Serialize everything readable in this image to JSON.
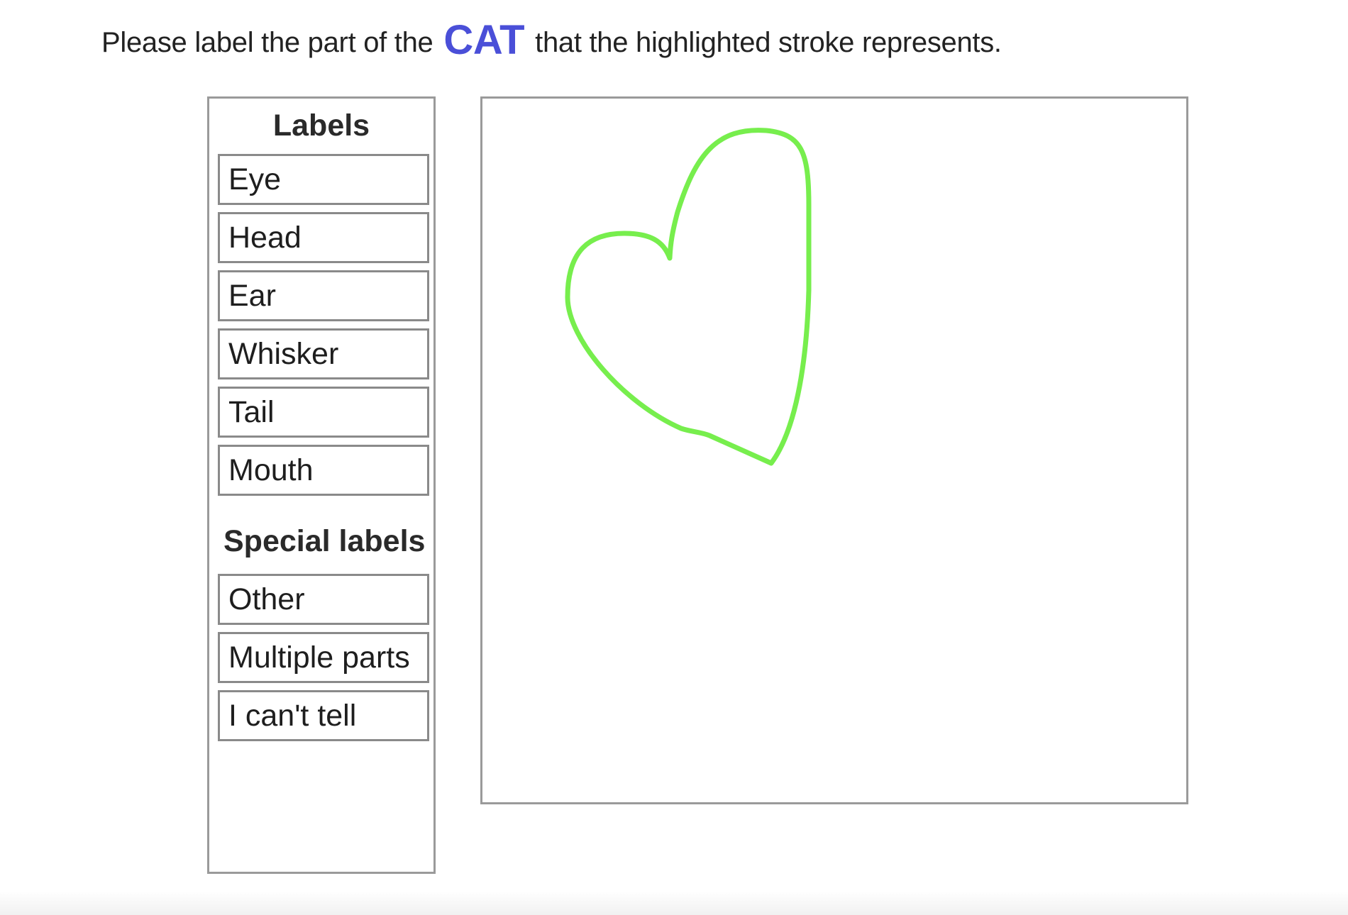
{
  "instruction": {
    "before": "Please label the part of the",
    "category": "CAT",
    "after": "that the highlighted stroke represents."
  },
  "labels_panel": {
    "heading": "Labels",
    "items": [
      "Eye",
      "Head",
      "Ear",
      "Whisker",
      "Tail",
      "Mouth"
    ],
    "special_heading": "Special labels",
    "special_items": [
      "Other",
      "Multiple parts",
      "I can't tell"
    ]
  },
  "canvas": {
    "stroke_color": "#77ee4d"
  },
  "colors": {
    "accent": "#4a4fd8",
    "border": "#9a9a9a"
  }
}
